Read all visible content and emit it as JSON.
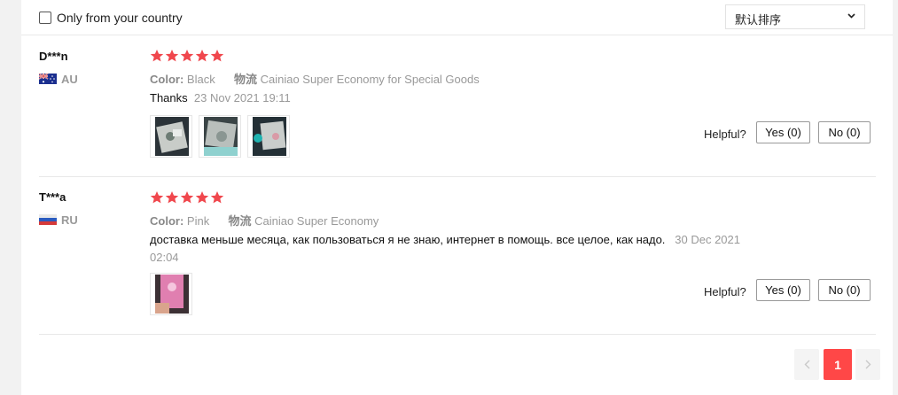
{
  "filter": {
    "only_country_label": "Only from your country",
    "checked": false
  },
  "sort": {
    "selected": "默认排序"
  },
  "reviews": [
    {
      "name": "D***n",
      "country": "AU",
      "rating": 5,
      "color_label": "Color:",
      "color_value": "Black",
      "shipping_label": "物流",
      "shipping_value": "Cainiao Super Economy for Special Goods",
      "text": "Thanks",
      "date": "23 Nov 2021 19:11",
      "photos": [
        "photo-1",
        "photo-2",
        "photo-3"
      ],
      "helpful_label": "Helpful?",
      "yes_label": "Yes (0)",
      "no_label": "No (0)"
    },
    {
      "name": "T***a",
      "country": "RU",
      "rating": 5,
      "color_label": "Color:",
      "color_value": "Pink",
      "shipping_label": "物流",
      "shipping_value": "Cainiao Super Economy",
      "text": "доставка меньше месяца, как пользоваться я не знаю, интернет в помощь. все целое, как надо.",
      "date": "30 Dec 2021 02:04",
      "photos": [
        "photo-1"
      ],
      "helpful_label": "Helpful?",
      "yes_label": "Yes (0)",
      "no_label": "No (0)"
    }
  ],
  "pagination": {
    "current_page": "1"
  },
  "colors": {
    "star": "#f0474d",
    "accent": "#ff4747",
    "muted": "#999999"
  },
  "icons": [
    "chevron-down-icon",
    "star-icon",
    "flag-au-icon",
    "flag-ru-icon",
    "chevron-left-icon",
    "chevron-right-icon"
  ]
}
